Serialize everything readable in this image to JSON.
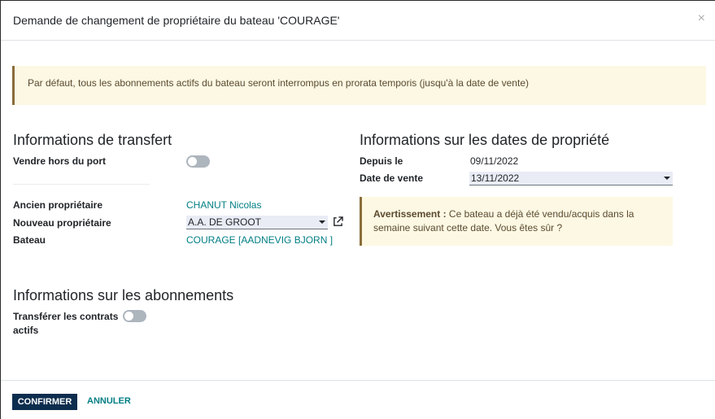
{
  "dialog": {
    "title": "Demande de changement de propriétaire du bateau 'COURAGE'",
    "close_icon": "×"
  },
  "info_alert": "Par défaut, tous les abonnements actifs du bateau seront interrompus en prorata temporis (jusqu'à la date de vente)",
  "transfer": {
    "title": "Informations de transfert",
    "sell_outside_port_label": "Vendre hors du port",
    "sell_outside_port_value": false,
    "old_owner_label": "Ancien propriétaire",
    "old_owner_value": "CHANUT Nicolas",
    "new_owner_label": "Nouveau propriétaire",
    "new_owner_value": "A.A. DE GROOT",
    "boat_label": "Bateau",
    "boat_value": "COURAGE [AADNEVIG BJORN ]"
  },
  "dates": {
    "title": "Informations sur les dates de propriété",
    "since_label": "Depuis le",
    "since_value": "09/11/2022",
    "sale_date_label": "Date de vente",
    "sale_date_value": "13/11/2022",
    "warning_label": "Avertissement :",
    "warning_text": " Ce bateau a déjà été vendu/acquis dans la semaine suivant cette date. Vous êtes sûr ?"
  },
  "subscriptions": {
    "title": "Informations sur les abonnements",
    "transfer_contracts_label_line1": "Transférer les contrats",
    "transfer_contracts_label_line2": "actifs",
    "transfer_contracts_value": false
  },
  "footer": {
    "confirm_label": "CONFIRMER",
    "cancel_label": "ANNULER"
  },
  "colors": {
    "primary": "#0d2d4e",
    "link": "#017e84",
    "alert_bg": "#fcf8e3",
    "alert_border": "#8a6d3b"
  }
}
